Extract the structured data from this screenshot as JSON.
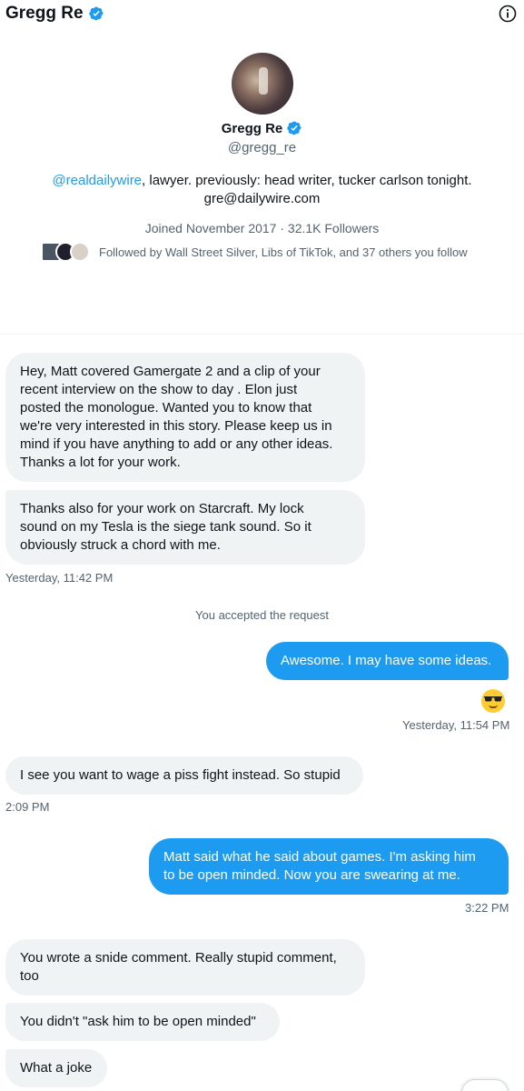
{
  "header": {
    "name": "Gregg Re"
  },
  "profile": {
    "name": "Gregg Re",
    "handle": "@gregg_re",
    "bio_link": "@realdailywire",
    "bio_rest": ", lawyer. previously: head writer, tucker carlson tonight.",
    "bio_email": "gre@dailywire.com",
    "meta": "Joined November 2017 · 32.1K Followers",
    "followed_by": "Followed by Wall Street Silver, Libs of TikTok, and 37 others you follow"
  },
  "messages": [
    {
      "dir": "recv",
      "lines": [
        "Hey, Matt covered Gamergate 2 and a clip of your",
        "recent interview on the show to day . Elon just",
        "posted the monologue. Wanted you to know that",
        "we're very interested in this story. Please keep us in",
        "mind if you have anything to add or any other ideas.",
        "Thanks a lot for your work."
      ]
    },
    {
      "dir": "recv",
      "lines": [
        "Thanks also for your work on Starcraft. My lock",
        "sound on my Tesla is the siege tank sound. So it",
        "obviously struck a chord with me."
      ]
    },
    {
      "dir": "sent",
      "lines": [
        "Awesome. I may have some ideas."
      ]
    },
    {
      "dir": "recv",
      "lines": [
        "I see you want to wage a piss fight instead. So stupid"
      ]
    },
    {
      "dir": "sent",
      "lines": [
        "Matt said what he said about games. I'm asking him",
        "to be open minded. Now you are swearing at me."
      ]
    },
    {
      "dir": "recv",
      "lines": [
        "You wrote a snide comment. Really stupid comment,",
        "too"
      ]
    },
    {
      "dir": "recv",
      "lines": [
        "You didn't \"ask him to be open minded\""
      ]
    },
    {
      "dir": "recv",
      "lines": [
        "What a joke"
      ]
    }
  ],
  "timestamps": {
    "t1": "Yesterday, 11:42 PM",
    "t2": "Yesterday, 11:54 PM",
    "t3": "2:09 PM",
    "t4": "3:22 PM"
  },
  "system": {
    "accepted": "You accepted the request"
  },
  "icons": {
    "verified": "verified-badge-icon",
    "info": "info-icon",
    "emoji": "sunglasses-emoji-icon"
  },
  "colors": {
    "accent": "#1d9bf0",
    "bubble_recv": "#eff3f4",
    "muted": "#536471"
  }
}
